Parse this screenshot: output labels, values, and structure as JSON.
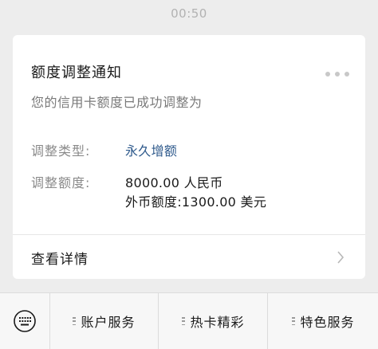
{
  "timestamp": "00:50",
  "card": {
    "title": "额度调整通知",
    "subtitle": "您的信用卡额度已成功调整为",
    "type_label": "调整类型:",
    "type_value": "永久增额",
    "amount_label": "调整额度:",
    "amount_value": "8000.00 人民币",
    "foreign_value": "外币额度:1300.00 美元",
    "detail_label": "查看详情",
    "more_icon": "more-dots-icon",
    "detail_icon": "chevron-right-icon"
  },
  "bottom_menu": {
    "keyboard_icon": "keyboard-icon",
    "items": [
      {
        "label": "账户服务",
        "icon": "menu-list-icon"
      },
      {
        "label": "热卡精彩",
        "icon": "menu-list-icon"
      },
      {
        "label": "特色服务",
        "icon": "menu-list-icon"
      }
    ]
  },
  "colors": {
    "background": "#ededed",
    "card": "#ffffff",
    "link": "#2f5a8c",
    "label_gray": "#8a8a8a",
    "timestamp_gray": "#b2b2b2"
  }
}
